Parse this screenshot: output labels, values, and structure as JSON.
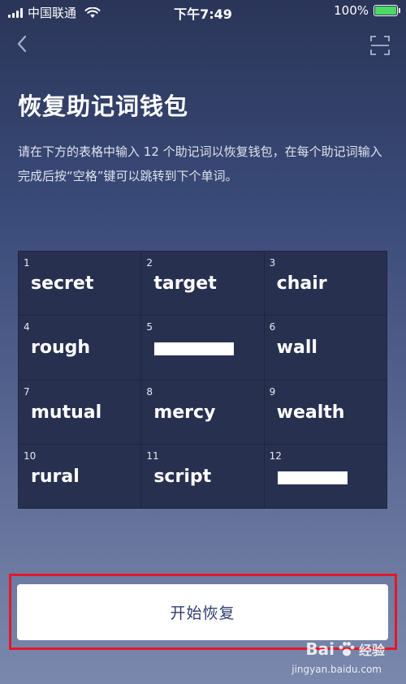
{
  "status_bar": {
    "carrier": "中国联通",
    "time": "下午7:49",
    "battery_percent": "100%",
    "battery_level": 1.0
  },
  "page": {
    "title": "恢复助记词钱包",
    "description": "请在下方的表格中输入 12 个助记词以恢复钱包，在每个助记词输入完成后按“空格”键可以跳转到下个单词。"
  },
  "words": [
    {
      "index": "1",
      "word": "secret"
    },
    {
      "index": "2",
      "word": "target"
    },
    {
      "index": "3",
      "word": "chair"
    },
    {
      "index": "4",
      "word": "rough"
    },
    {
      "index": "5",
      "word": ""
    },
    {
      "index": "6",
      "word": "wall"
    },
    {
      "index": "7",
      "word": "mutual"
    },
    {
      "index": "8",
      "word": "mercy"
    },
    {
      "index": "9",
      "word": "wealth"
    },
    {
      "index": "10",
      "word": "rural"
    },
    {
      "index": "11",
      "word": "script"
    },
    {
      "index": "12",
      "word": ""
    }
  ],
  "actions": {
    "start_restore": "开始恢复"
  },
  "watermark": {
    "brand": "Bai",
    "brand_suffix": "经验",
    "url": "jingyan.baidu.com"
  },
  "icons": {
    "back": "chevron-left-icon",
    "scan": "scan-frame-icon",
    "wifi": "wifi-icon",
    "battery": "battery-icon"
  },
  "colors": {
    "accent_green": "#4cd964",
    "highlight_red": "#e2182a",
    "button_text": "#2f3c6e"
  }
}
